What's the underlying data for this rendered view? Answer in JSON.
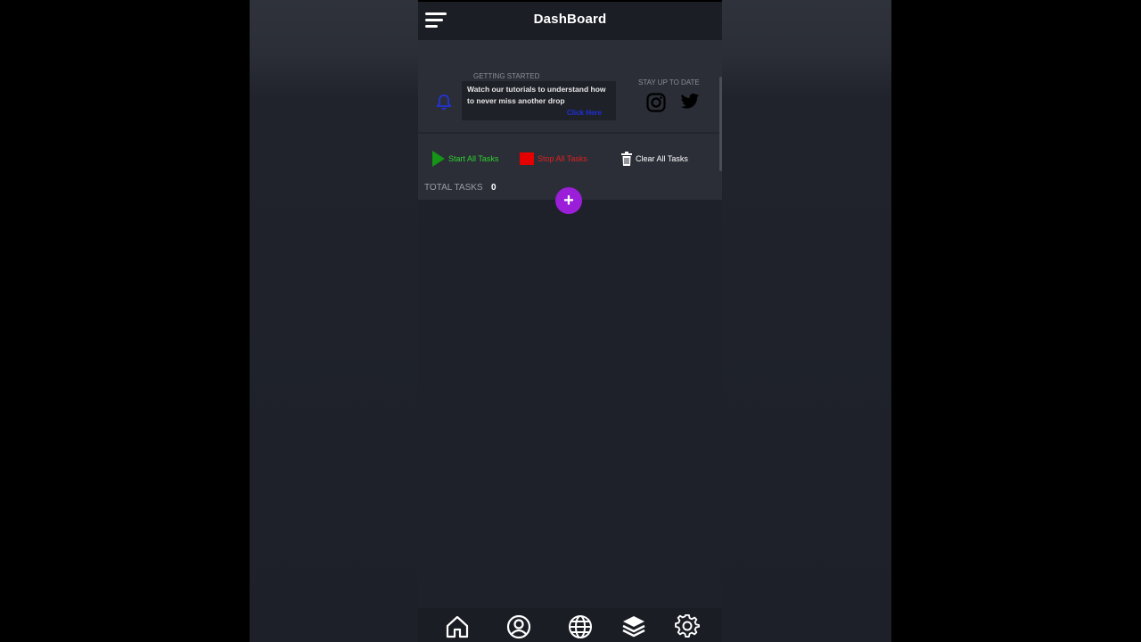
{
  "header": {
    "title": "DashBoard"
  },
  "getting_started": {
    "label": "GETTING STARTED",
    "tutorial_text": "Watch our tutorials to understand how to never miss another drop",
    "link_label": "Click Here"
  },
  "social": {
    "label": "STAY UP TO DATE",
    "icons": [
      "instagram-icon",
      "twitter-icon"
    ]
  },
  "actions": {
    "start_label": "Start All Tasks",
    "stop_label": "Stop All Tasks",
    "clear_label": "Clear All Tasks"
  },
  "tasks": {
    "total_label": "TOTAL TASKS",
    "total_value": "0"
  },
  "add_button": {
    "symbol": "+"
  },
  "nav": {
    "items": [
      "home-icon",
      "profile-icon",
      "globe-icon",
      "layers-icon",
      "settings-icon"
    ]
  },
  "colors": {
    "accent_purple": "#9b1ed8",
    "start_green": "#2fd12f",
    "stop_red": "#e02020",
    "link_blue": "#1f2fd8"
  }
}
